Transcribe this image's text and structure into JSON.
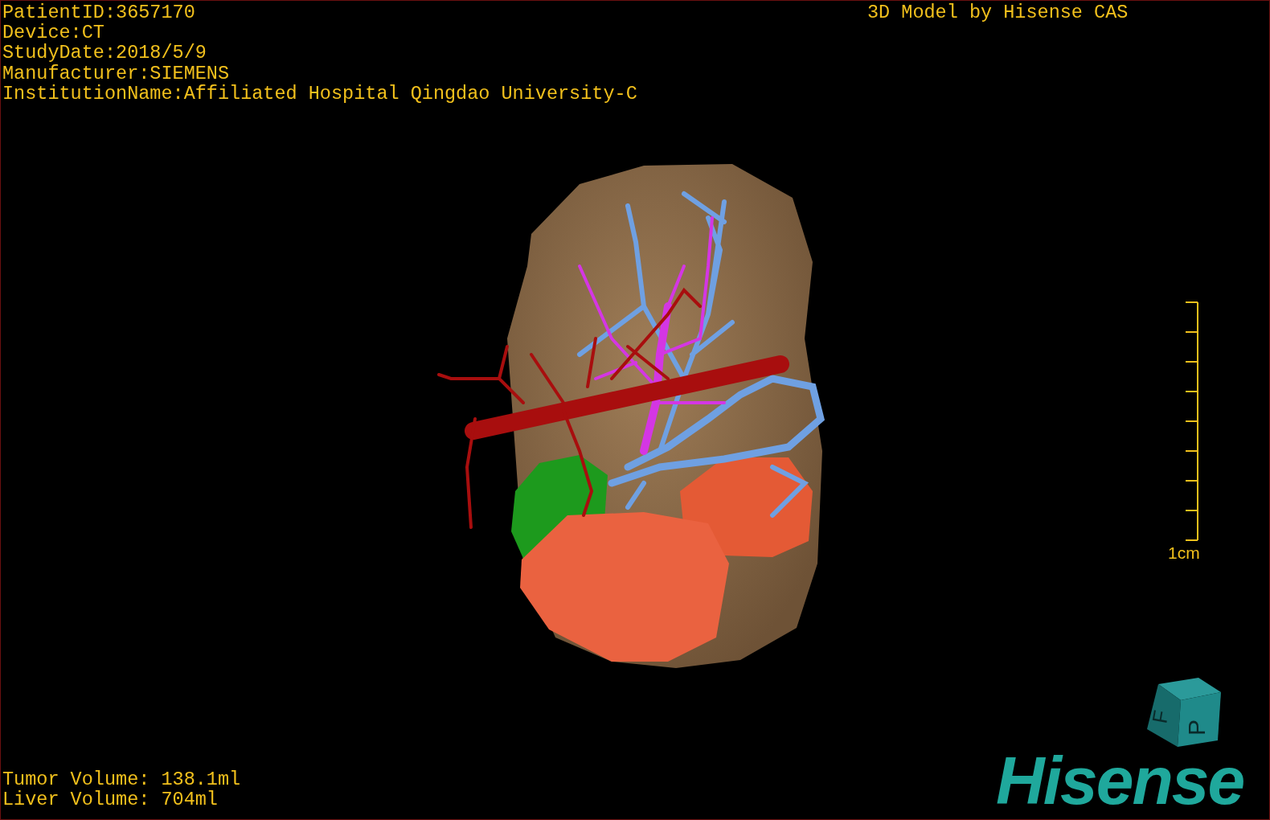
{
  "header_left": [
    "PatientID:3657170",
    "Device:CT",
    "StudyDate:2018/5/9",
    "Manufacturer:SIEMENS",
    "InstitutionName:Affiliated Hospital Qingdao University-C"
  ],
  "header_right": "3D Model by Hisense CAS",
  "scale_bar": {
    "label": "1cm"
  },
  "volumes": [
    "Tumor Volume: 138.1ml",
    "Liver Volume: 704ml"
  ],
  "orientation_cube": {
    "labels": [
      "F",
      "P"
    ]
  },
  "logo": "Hisense"
}
